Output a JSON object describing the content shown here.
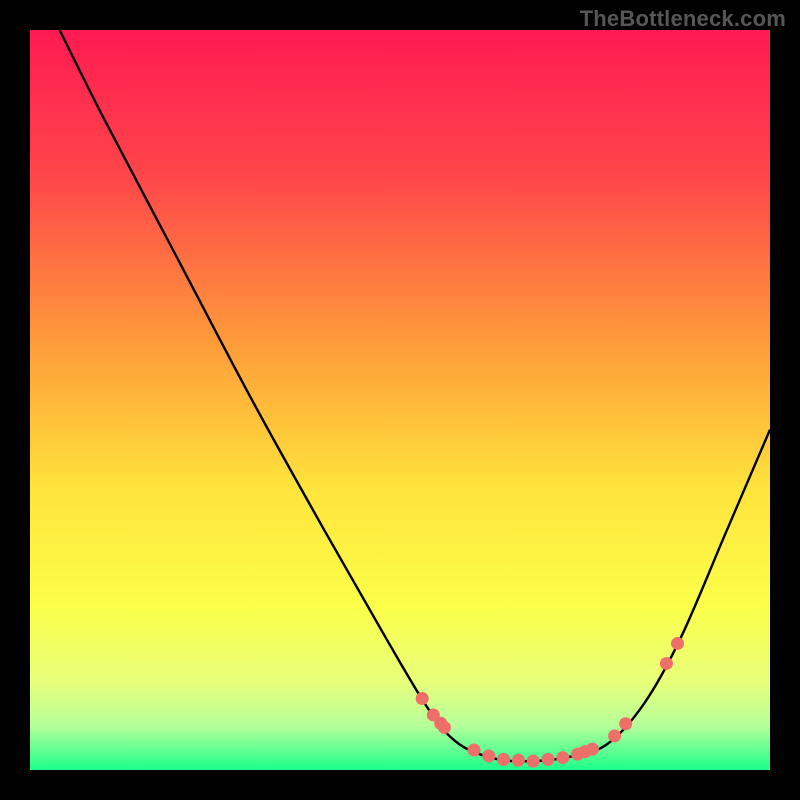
{
  "attribution": "TheBottleneck.com",
  "chart_data": {
    "type": "line",
    "title": "",
    "xlabel": "",
    "ylabel": "",
    "xlim": [
      0,
      100
    ],
    "ylim": [
      0,
      100
    ],
    "grid": false,
    "legend": "none",
    "curve": {
      "points": [
        [
          4,
          100
        ],
        [
          10,
          88
        ],
        [
          20,
          69
        ],
        [
          30,
          50
        ],
        [
          40,
          32
        ],
        [
          48,
          18
        ],
        [
          54,
          8
        ],
        [
          58,
          3.5
        ],
        [
          63,
          1.5
        ],
        [
          68,
          1.2
        ],
        [
          73,
          1.8
        ],
        [
          78,
          3.5
        ],
        [
          83,
          9
        ],
        [
          88,
          18
        ],
        [
          94,
          32
        ],
        [
          100,
          46
        ]
      ]
    },
    "highlights": {
      "x": [
        53,
        54.5,
        55.5,
        56,
        60,
        62,
        64,
        66,
        68,
        70,
        72,
        74,
        75,
        76,
        79,
        80.5,
        86,
        87.5
      ],
      "color": "#ee6e6a"
    },
    "background_gradient": {
      "stops": [
        {
          "offset": 0,
          "color": "#ff1a52"
        },
        {
          "offset": 20,
          "color": "#ff474a"
        },
        {
          "offset": 42,
          "color": "#ff9a3a"
        },
        {
          "offset": 62,
          "color": "#ffe43b"
        },
        {
          "offset": 78,
          "color": "#fbff4a"
        },
        {
          "offset": 88,
          "color": "#e8ff7a"
        },
        {
          "offset": 94,
          "color": "#b6ff9a"
        },
        {
          "offset": 100,
          "color": "#1bff8a"
        }
      ]
    }
  }
}
